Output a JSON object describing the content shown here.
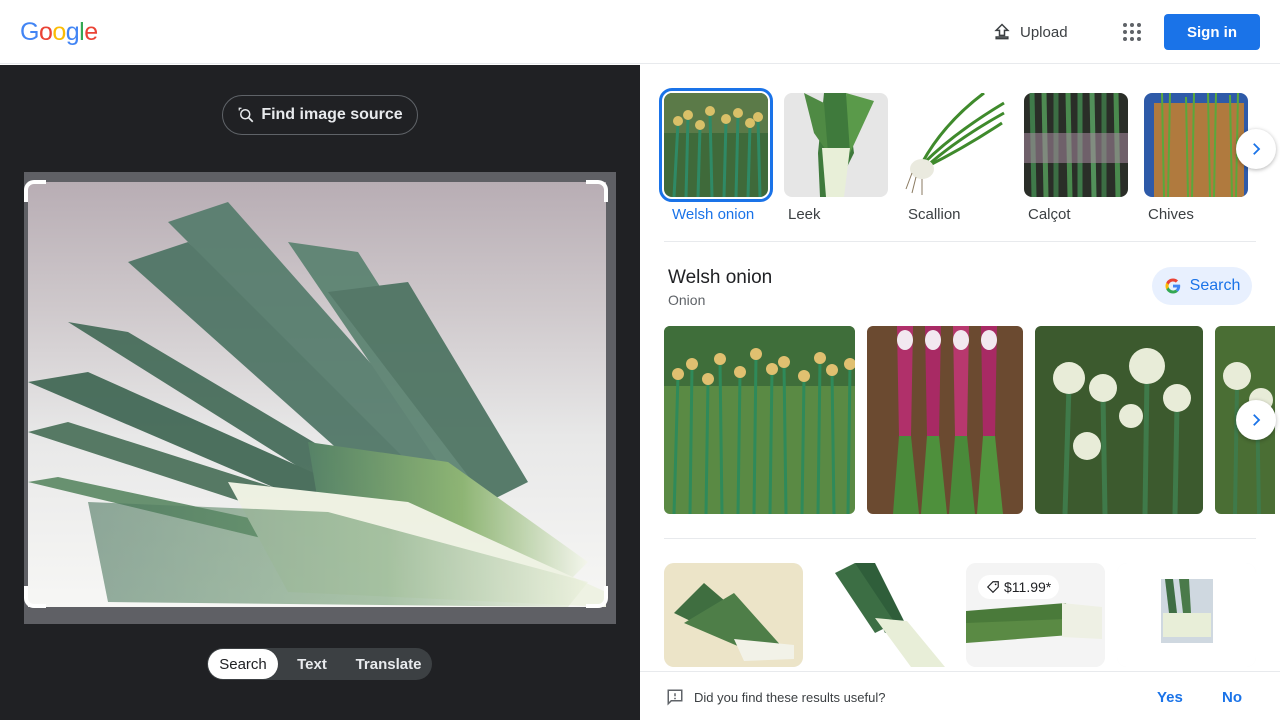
{
  "header": {
    "logo_letters": [
      {
        "ch": "G",
        "color": "#4285f4"
      },
      {
        "ch": "o",
        "color": "#ea4335"
      },
      {
        "ch": "o",
        "color": "#fbbc05"
      },
      {
        "ch": "g",
        "color": "#4285f4"
      },
      {
        "ch": "l",
        "color": "#34a853"
      },
      {
        "ch": "e",
        "color": "#ea4335"
      }
    ],
    "upload_label": "Upload",
    "apps_icon": "apps-grid-icon",
    "signin_label": "Sign in"
  },
  "left_panel": {
    "find_source_label": "Find image source",
    "modes": [
      {
        "label": "Search",
        "active": true
      },
      {
        "label": "Text",
        "active": false
      },
      {
        "label": "Translate",
        "active": false
      }
    ]
  },
  "entities": [
    {
      "label": "Welsh onion",
      "selected": true
    },
    {
      "label": "Leek",
      "selected": false
    },
    {
      "label": "Scallion",
      "selected": false
    },
    {
      "label": "Calçot",
      "selected": false
    },
    {
      "label": "Chives",
      "selected": false
    }
  ],
  "knowledge": {
    "title": "Welsh onion",
    "subtitle": "Onion",
    "search_label": "Search"
  },
  "visual_matches": {
    "price_tag": "$11.99*"
  },
  "feedback": {
    "question": "Did you find these results useful?",
    "yes": "Yes",
    "no": "No"
  },
  "colors": {
    "accent": "#1a73e8",
    "dark_panel": "#202124"
  }
}
